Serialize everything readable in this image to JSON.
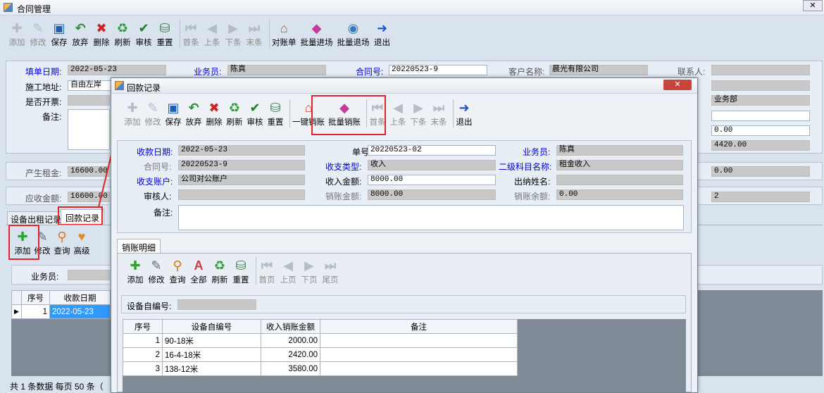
{
  "main_window": {
    "title": "合同管理",
    "toolbar": [
      {
        "label": "添加",
        "icon": "plus-icon",
        "enabled": false
      },
      {
        "label": "修改",
        "icon": "edit-icon",
        "enabled": false
      },
      {
        "label": "保存",
        "icon": "save-icon",
        "enabled": true
      },
      {
        "label": "放弃",
        "icon": "undo-icon",
        "enabled": true
      },
      {
        "label": "删除",
        "icon": "delete-icon",
        "enabled": true
      },
      {
        "label": "刷新",
        "icon": "refresh-icon",
        "enabled": true
      },
      {
        "label": "审核",
        "icon": "check-icon",
        "enabled": true
      },
      {
        "label": "重置",
        "icon": "reset-icon",
        "enabled": true
      },
      {
        "label": "首条",
        "icon": "first-icon",
        "enabled": false
      },
      {
        "label": "上条",
        "icon": "prev-icon",
        "enabled": false
      },
      {
        "label": "下条",
        "icon": "next-icon",
        "enabled": false
      },
      {
        "label": "末条",
        "icon": "last-icon",
        "enabled": false
      },
      {
        "label": "对账单",
        "icon": "house-icon",
        "enabled": true
      },
      {
        "label": "批量进场",
        "icon": "batch-in-icon",
        "enabled": true
      },
      {
        "label": "批量退场",
        "icon": "batch-out-icon",
        "enabled": true
      },
      {
        "label": "退出",
        "icon": "exit-icon",
        "enabled": true
      }
    ],
    "form": {
      "fill_date_label": "填单日期:",
      "fill_date": "2022-05-23",
      "salesman_label": "业务员:",
      "salesman": "陈真",
      "contract_no_label": "合同号:",
      "contract_no": "20220523-9",
      "customer_label": "客户名称:",
      "customer": "晨光有限公司",
      "contact_label": "联系人:",
      "site_label": "施工地址:",
      "site": "自由左岸",
      "invoice_label": "是否开票:",
      "remark_label": "备注:",
      "dept_value": "业务部",
      "right_value_1": "0.00",
      "right_value_2": "4420.00",
      "rent_label": "产生租金:",
      "rent": "16600.00",
      "right_value_3": "0.00",
      "receivable_label": "应收金额:",
      "receivable": "16600.00",
      "right_value_4": "2"
    },
    "tabs": [
      "设备出租记录",
      "回款记录"
    ],
    "sub_toolbar": [
      {
        "label": "添加",
        "icon": "plus-icon"
      },
      {
        "label": "修改",
        "icon": "edit-icon"
      },
      {
        "label": "查询",
        "icon": "search-icon"
      },
      {
        "label": "高级",
        "icon": "advanced-search-icon"
      }
    ],
    "filter_label": "业务员:",
    "grid": {
      "headers": [
        "序号",
        "收款日期"
      ],
      "rows": [
        {
          "no": "1",
          "date": "2022-05-23"
        }
      ]
    },
    "status": "共 1 条数据  每页 50 条（"
  },
  "dialog": {
    "title": "回款记录",
    "toolbar": [
      {
        "label": "添加",
        "icon": "plus-icon",
        "enabled": false
      },
      {
        "label": "修改",
        "icon": "edit-icon",
        "enabled": false
      },
      {
        "label": "保存",
        "icon": "save-icon",
        "enabled": true
      },
      {
        "label": "放弃",
        "icon": "undo-icon",
        "enabled": true
      },
      {
        "label": "删除",
        "icon": "delete-icon",
        "enabled": true
      },
      {
        "label": "刷新",
        "icon": "refresh-icon",
        "enabled": true
      },
      {
        "label": "审核",
        "icon": "check-icon",
        "enabled": true
      },
      {
        "label": "重置",
        "icon": "reset-icon",
        "enabled": true
      },
      {
        "label": "一键销账",
        "icon": "house-icon",
        "enabled": true
      },
      {
        "label": "批量销账",
        "icon": "batch-writeoff-icon",
        "enabled": true
      },
      {
        "label": "首条",
        "icon": "first-icon",
        "enabled": false
      },
      {
        "label": "上条",
        "icon": "prev-icon",
        "enabled": false
      },
      {
        "label": "下条",
        "icon": "next-icon",
        "enabled": false
      },
      {
        "label": "末条",
        "icon": "last-icon",
        "enabled": false
      },
      {
        "label": "退出",
        "icon": "exit-icon",
        "enabled": true
      }
    ],
    "form": {
      "receipt_date_label": "收款日期:",
      "receipt_date": "2022-05-23",
      "doc_no_label": "单号:",
      "doc_no": "20220523-02",
      "salesman_label": "业务员:",
      "salesman": "陈真",
      "contract_label": "合同号:",
      "contract": "20220523-9",
      "type_label": "收支类型:",
      "type": "收入",
      "subject_label": "二级科目名称:",
      "subject": "租金收入",
      "account_label": "收支账户:",
      "account": "公司对公账户",
      "amount_label": "收入金额:",
      "amount": "8000.00",
      "cashier_label": "出纳姓名:",
      "auditor_label": "审核人:",
      "written_off_label": "销账金额:",
      "written_off": "8000.00",
      "balance_label": "销账余额:",
      "balance": "0.00",
      "remark_label": "备注:"
    },
    "detail_tab": "销账明细",
    "detail_toolbar": [
      {
        "label": "添加",
        "icon": "plus-icon",
        "enabled": true
      },
      {
        "label": "修改",
        "icon": "edit-icon",
        "enabled": true
      },
      {
        "label": "查询",
        "icon": "search-icon",
        "enabled": true
      },
      {
        "label": "全部",
        "icon": "all-icon",
        "enabled": true
      },
      {
        "label": "刷新",
        "icon": "refresh-icon",
        "enabled": true
      },
      {
        "label": "重置",
        "icon": "reset-icon",
        "enabled": true
      },
      {
        "label": "首页",
        "icon": "first-icon",
        "enabled": false
      },
      {
        "label": "上页",
        "icon": "prev-icon",
        "enabled": false
      },
      {
        "label": "下页",
        "icon": "next-icon",
        "enabled": false
      },
      {
        "label": "尾页",
        "icon": "last-icon",
        "enabled": false
      }
    ],
    "equip_filter_label": "设备自编号:",
    "grid": {
      "headers": [
        "序号",
        "设备自编号",
        "收入销账金额",
        "备注"
      ],
      "rows": [
        {
          "no": "1",
          "code": "90-18米",
          "amount": "2000.00",
          "remark": ""
        },
        {
          "no": "2",
          "code": "16-4-18米",
          "amount": "2420.00",
          "remark": ""
        },
        {
          "no": "3",
          "code": "138-12米",
          "amount": "3580.00",
          "remark": ""
        }
      ]
    }
  },
  "colors": {
    "highlight": "#e0242a",
    "window_bg": "#d9e3ee",
    "label_blue": "#0000d0"
  }
}
